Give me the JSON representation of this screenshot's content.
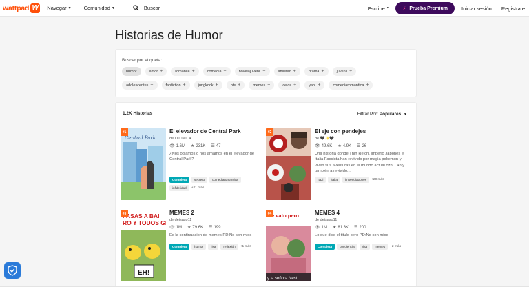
{
  "nav": {
    "logo_text": "wattpad",
    "logo_mark": "W",
    "browse": "Navegar",
    "community": "Comunidad",
    "search_label": "Buscar",
    "write": "Escribe",
    "premium": "Prueba Premium",
    "login": "Iniciar sesión",
    "register": "Registrate",
    "brand_color": "#ff500a",
    "premium_color": "#3d0a5c"
  },
  "page": {
    "title": "Historias de Humor"
  },
  "tags": {
    "label": "Buscar por etiqueta:",
    "row1": [
      "humor",
      "amor",
      "romance",
      "comedia",
      "novelajuvenil",
      "amistad",
      "drama",
      "juvenil"
    ],
    "row2": [
      "adolescentes",
      "fanfiction",
      "jungkook",
      "bts",
      "memes",
      "celos",
      "yaoi",
      "comediaromantica"
    ]
  },
  "stories": {
    "count": "1.2K Historias",
    "filter_label": "Filtrar Por:",
    "filter_value": "Populares",
    "items": [
      {
        "rank": "#1",
        "title": "El elevador de Central Park",
        "author": "de LUDMILA",
        "reads": "1.6M",
        "votes": "231K",
        "parts": "47",
        "desc": "¿Nos odiamos o nos amamos en el elevador de Central Park?",
        "tags": [
          "Completa",
          "secreto",
          "comediaromantica",
          "infidelidad"
        ],
        "more": "+21 más",
        "cover_text": "Central Park"
      },
      {
        "rank": "#2",
        "title": "El eje con pendejes",
        "author": "de 🖤✨🖤",
        "reads": "49.6K",
        "votes": "4.9K",
        "parts": "26",
        "desc": "Una historia donde Thirt Reich, Imperio Japonés e Italia Fascista han revivido por magia pokemon y viven sus aventuras en el mundo actual ozhi . Ah y también a revivido...",
        "tags": [
          "nazi",
          "italia",
          "imperiojapones"
        ],
        "more": "+20 más",
        "cover_text": ""
      },
      {
        "rank": "#3",
        "title": "MEMES 2",
        "author": "de deisaso11",
        "reads": "1M",
        "votes": "79.6K",
        "parts": "199",
        "desc": "Es la continuacion de memes PD:No son mios",
        "tags": [
          "Completa",
          "humor",
          "risa",
          "reflexión"
        ],
        "more": "+1 más",
        "cover_text": "PASAS A BAI\nRO Y TODOS GR",
        "cover_sub": "EH!"
      },
      {
        "rank": "#4",
        "title": "MEMES 4",
        "author": "de deisaso11",
        "reads": "1M",
        "votes": "81.3K",
        "parts": "200",
        "desc": "Lo que dice el titulo pero PD:No son mios",
        "tags": [
          "Completa",
          "conciencia",
          "risa",
          "memes"
        ],
        "more": "+2 más",
        "cover_text": "Se vato pero",
        "cover_sub": "y la señora Nest"
      }
    ]
  }
}
